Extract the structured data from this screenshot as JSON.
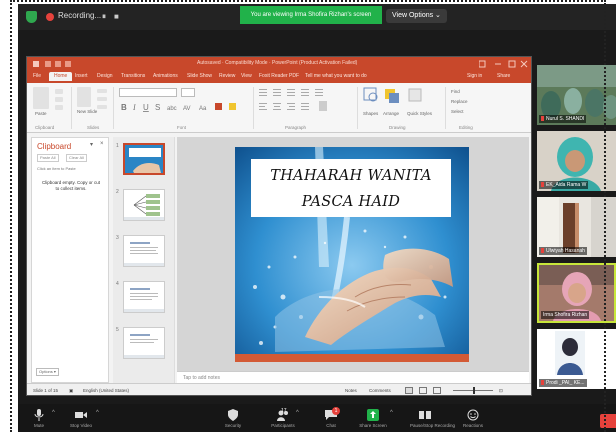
{
  "zoom": {
    "recording_label": "Recording...",
    "recording_controls": [
      "⏸",
      "■"
    ],
    "viewing_banner": "You are viewing Irma Shofira Rizhan's screen",
    "view_options": "View Options ⌄"
  },
  "ppt": {
    "window_title": "Autosaved · Compatibility Mode · PowerPoint (Product Activation Failed)",
    "tabs": [
      "File",
      "Home",
      "Insert",
      "Design",
      "Transitions",
      "Animations",
      "Slide Show",
      "Review",
      "View",
      "Foxit Reader PDF",
      "Tell me what you want to do"
    ],
    "tabs_right": [
      "Sign in",
      "Share"
    ],
    "ribbon_groups": [
      "Clipboard",
      "Slides",
      "Font",
      "Paragraph",
      "Drawing",
      "Editing"
    ],
    "ribbon_labels": {
      "paste": "Paste",
      "new_slide": "New Slide",
      "shapes": "Shapes",
      "arrange": "Arrange",
      "quick_styles": "Quick Styles",
      "find": "Find",
      "replace": "Replace",
      "select": "Select"
    },
    "clipboard": {
      "title": "Clipboard",
      "paste_all": "Paste All",
      "clear_all": "Clear All",
      "hint": "Click an item to Paste",
      "empty": "Clipboard empty. Copy or cut to collect items.",
      "options": "Options ▾"
    },
    "thumb_numbers": [
      "1",
      "2",
      "3",
      "4",
      "5"
    ],
    "slide_title_lines": [
      "THAHARAH WANITA",
      "PASCA HAID"
    ],
    "notes_placeholder": "Tap to add notes",
    "status": {
      "slide_count": "Slide 1 of 15",
      "language": "English (United States)",
      "notes": "Notes",
      "comments": "Comments"
    }
  },
  "participants": [
    {
      "name": "Nurul S. SHANDI"
    },
    {
      "name": "EK_Aida Rama W"
    },
    {
      "name": "Ulwiyah Hasanah"
    },
    {
      "name": "Irma Shofira Rizhan"
    },
    {
      "name": "Prodi _PAI_ KE..."
    }
  ],
  "toolbar": [
    {
      "label": "Mute"
    },
    {
      "label": "Stop Video"
    },
    {
      "label": "Security"
    },
    {
      "label": "Participants",
      "count": "17"
    },
    {
      "label": "Chat",
      "badge": "1"
    },
    {
      "label": "Share Screen"
    },
    {
      "label": "Pause/Stop Recording"
    },
    {
      "label": "Reactions"
    }
  ],
  "colors": {
    "ppt_accent": "#c8482b",
    "zoom_green": "#21b24a",
    "slide_footer": "#d35a35",
    "record_red": "#e6423c"
  }
}
